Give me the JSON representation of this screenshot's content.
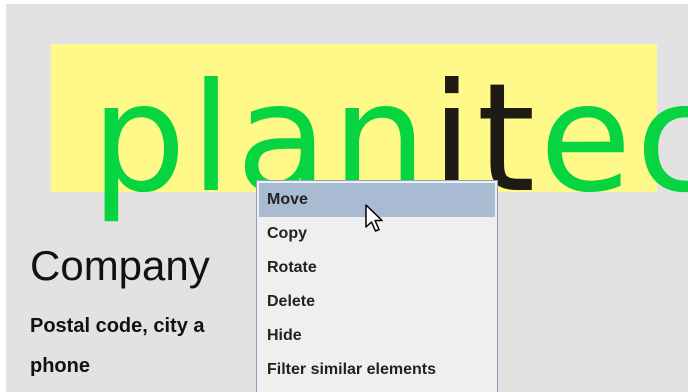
{
  "logo": {
    "text_before": "plan",
    "text_highlight": "it",
    "text_after": "ec",
    "colors": {
      "box": "#fff98a",
      "green": "#06d440",
      "dark": "#1e1a14"
    }
  },
  "company": {
    "name": "Company",
    "address": "Postal code, city a",
    "phone": "phone"
  },
  "context_menu": {
    "items": [
      {
        "label": "Move",
        "selected": true
      },
      {
        "label": "Copy"
      },
      {
        "label": "Rotate"
      },
      {
        "label": "Delete"
      },
      {
        "label": "Hide"
      },
      {
        "label": "Filter similar elements"
      }
    ],
    "selection_color": "#a9bbd3"
  },
  "cursor": {
    "icon": "arrow-pointer-icon"
  }
}
